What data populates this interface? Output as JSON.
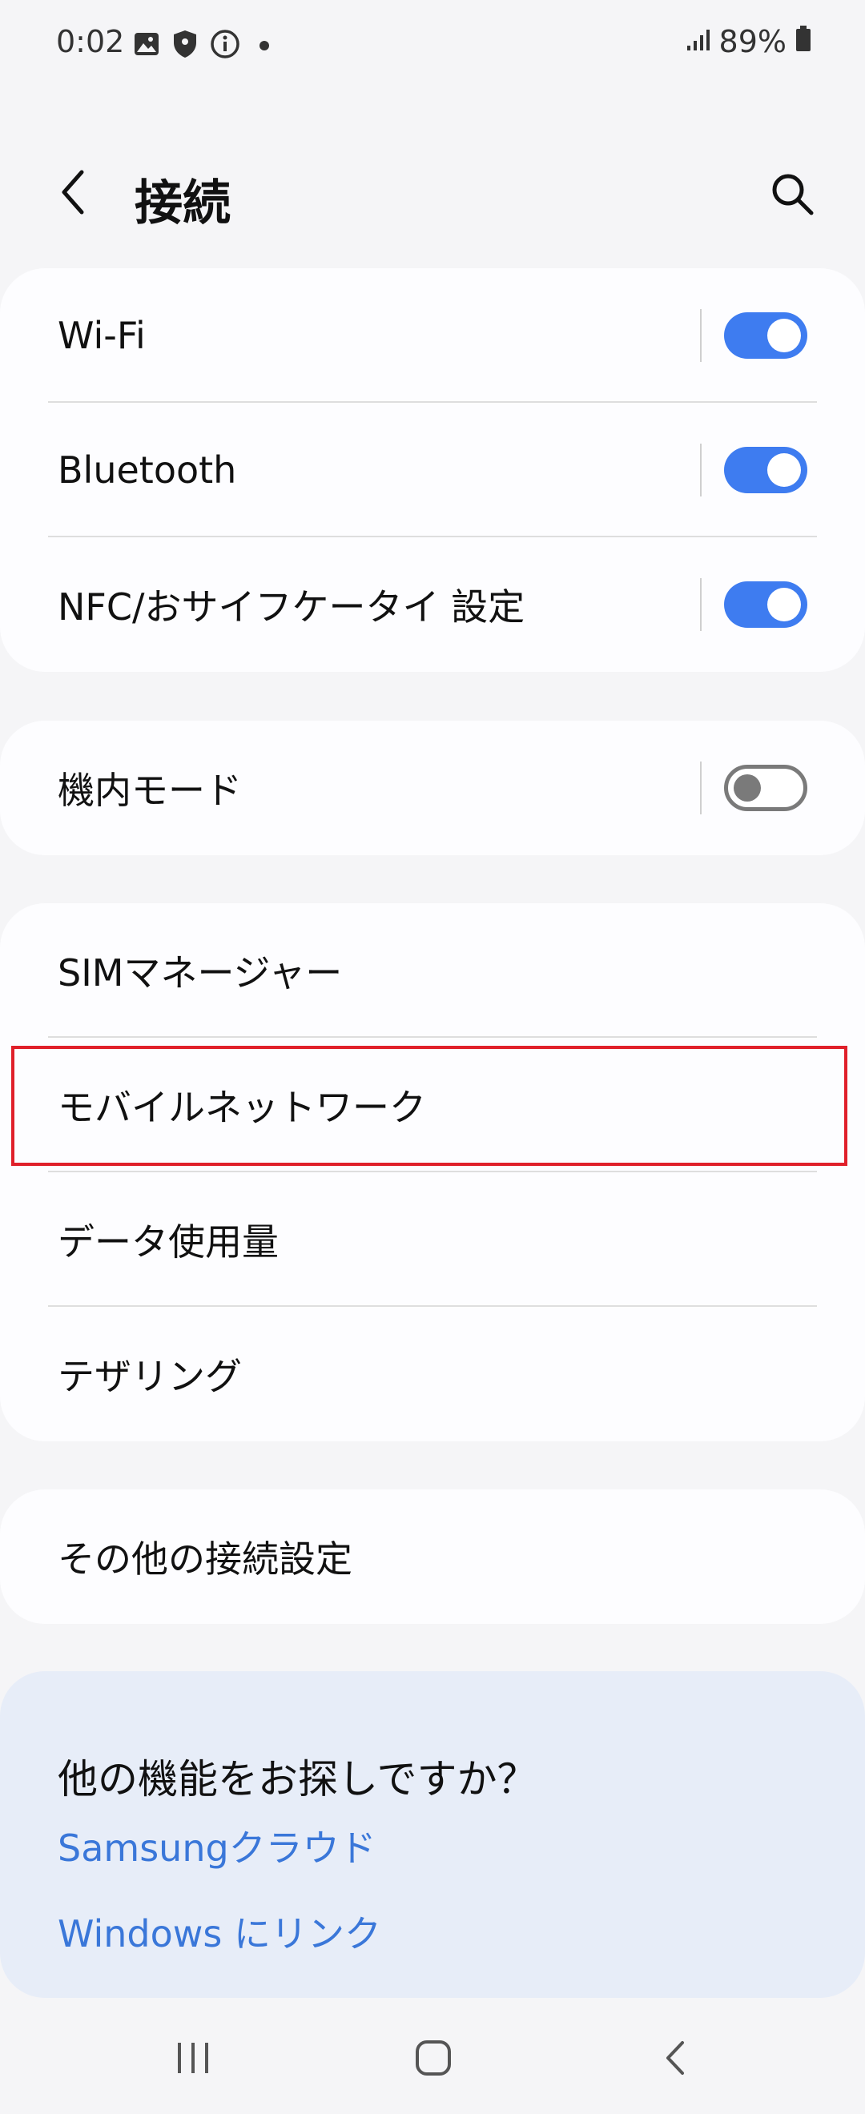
{
  "status_bar": {
    "time": "0:02",
    "battery": "89%",
    "icons": [
      "gallery-icon",
      "shield-icon",
      "info-icon",
      "notification-dot",
      "signal-icon",
      "battery-icon"
    ]
  },
  "header": {
    "title": "接続",
    "icons": [
      "back-arrow-icon",
      "search-icon"
    ]
  },
  "groups": [
    {
      "items": [
        {
          "label": "Wi-Fi",
          "toggle": true
        },
        {
          "label": "Bluetooth",
          "toggle": true
        },
        {
          "label": "NFC/おサイフケータイ 設定",
          "toggle": true
        }
      ]
    },
    {
      "items": [
        {
          "label": "機内モード",
          "toggle": false
        }
      ]
    },
    {
      "items": [
        {
          "label": "SIMマネージャー"
        },
        {
          "label": "モバイルネットワーク",
          "highlighted": true
        },
        {
          "label": "データ使用量"
        },
        {
          "label": "テザリング"
        }
      ]
    },
    {
      "items": [
        {
          "label": "その他の接続設定"
        }
      ]
    }
  ],
  "promo": {
    "title": "他の機能をお探しですか？",
    "links": [
      "Samsungクラウド",
      "Windows にリンク"
    ]
  },
  "colors": {
    "accent": "#3e7cf0",
    "link": "#3a77d9",
    "highlight_border": "#e0202a",
    "background": "#f5f5f7",
    "card": "#fdfdff",
    "promo_card": "#e7edf8"
  },
  "navbar": {
    "icons": [
      "recent-apps-icon",
      "home-icon",
      "back-icon"
    ]
  }
}
